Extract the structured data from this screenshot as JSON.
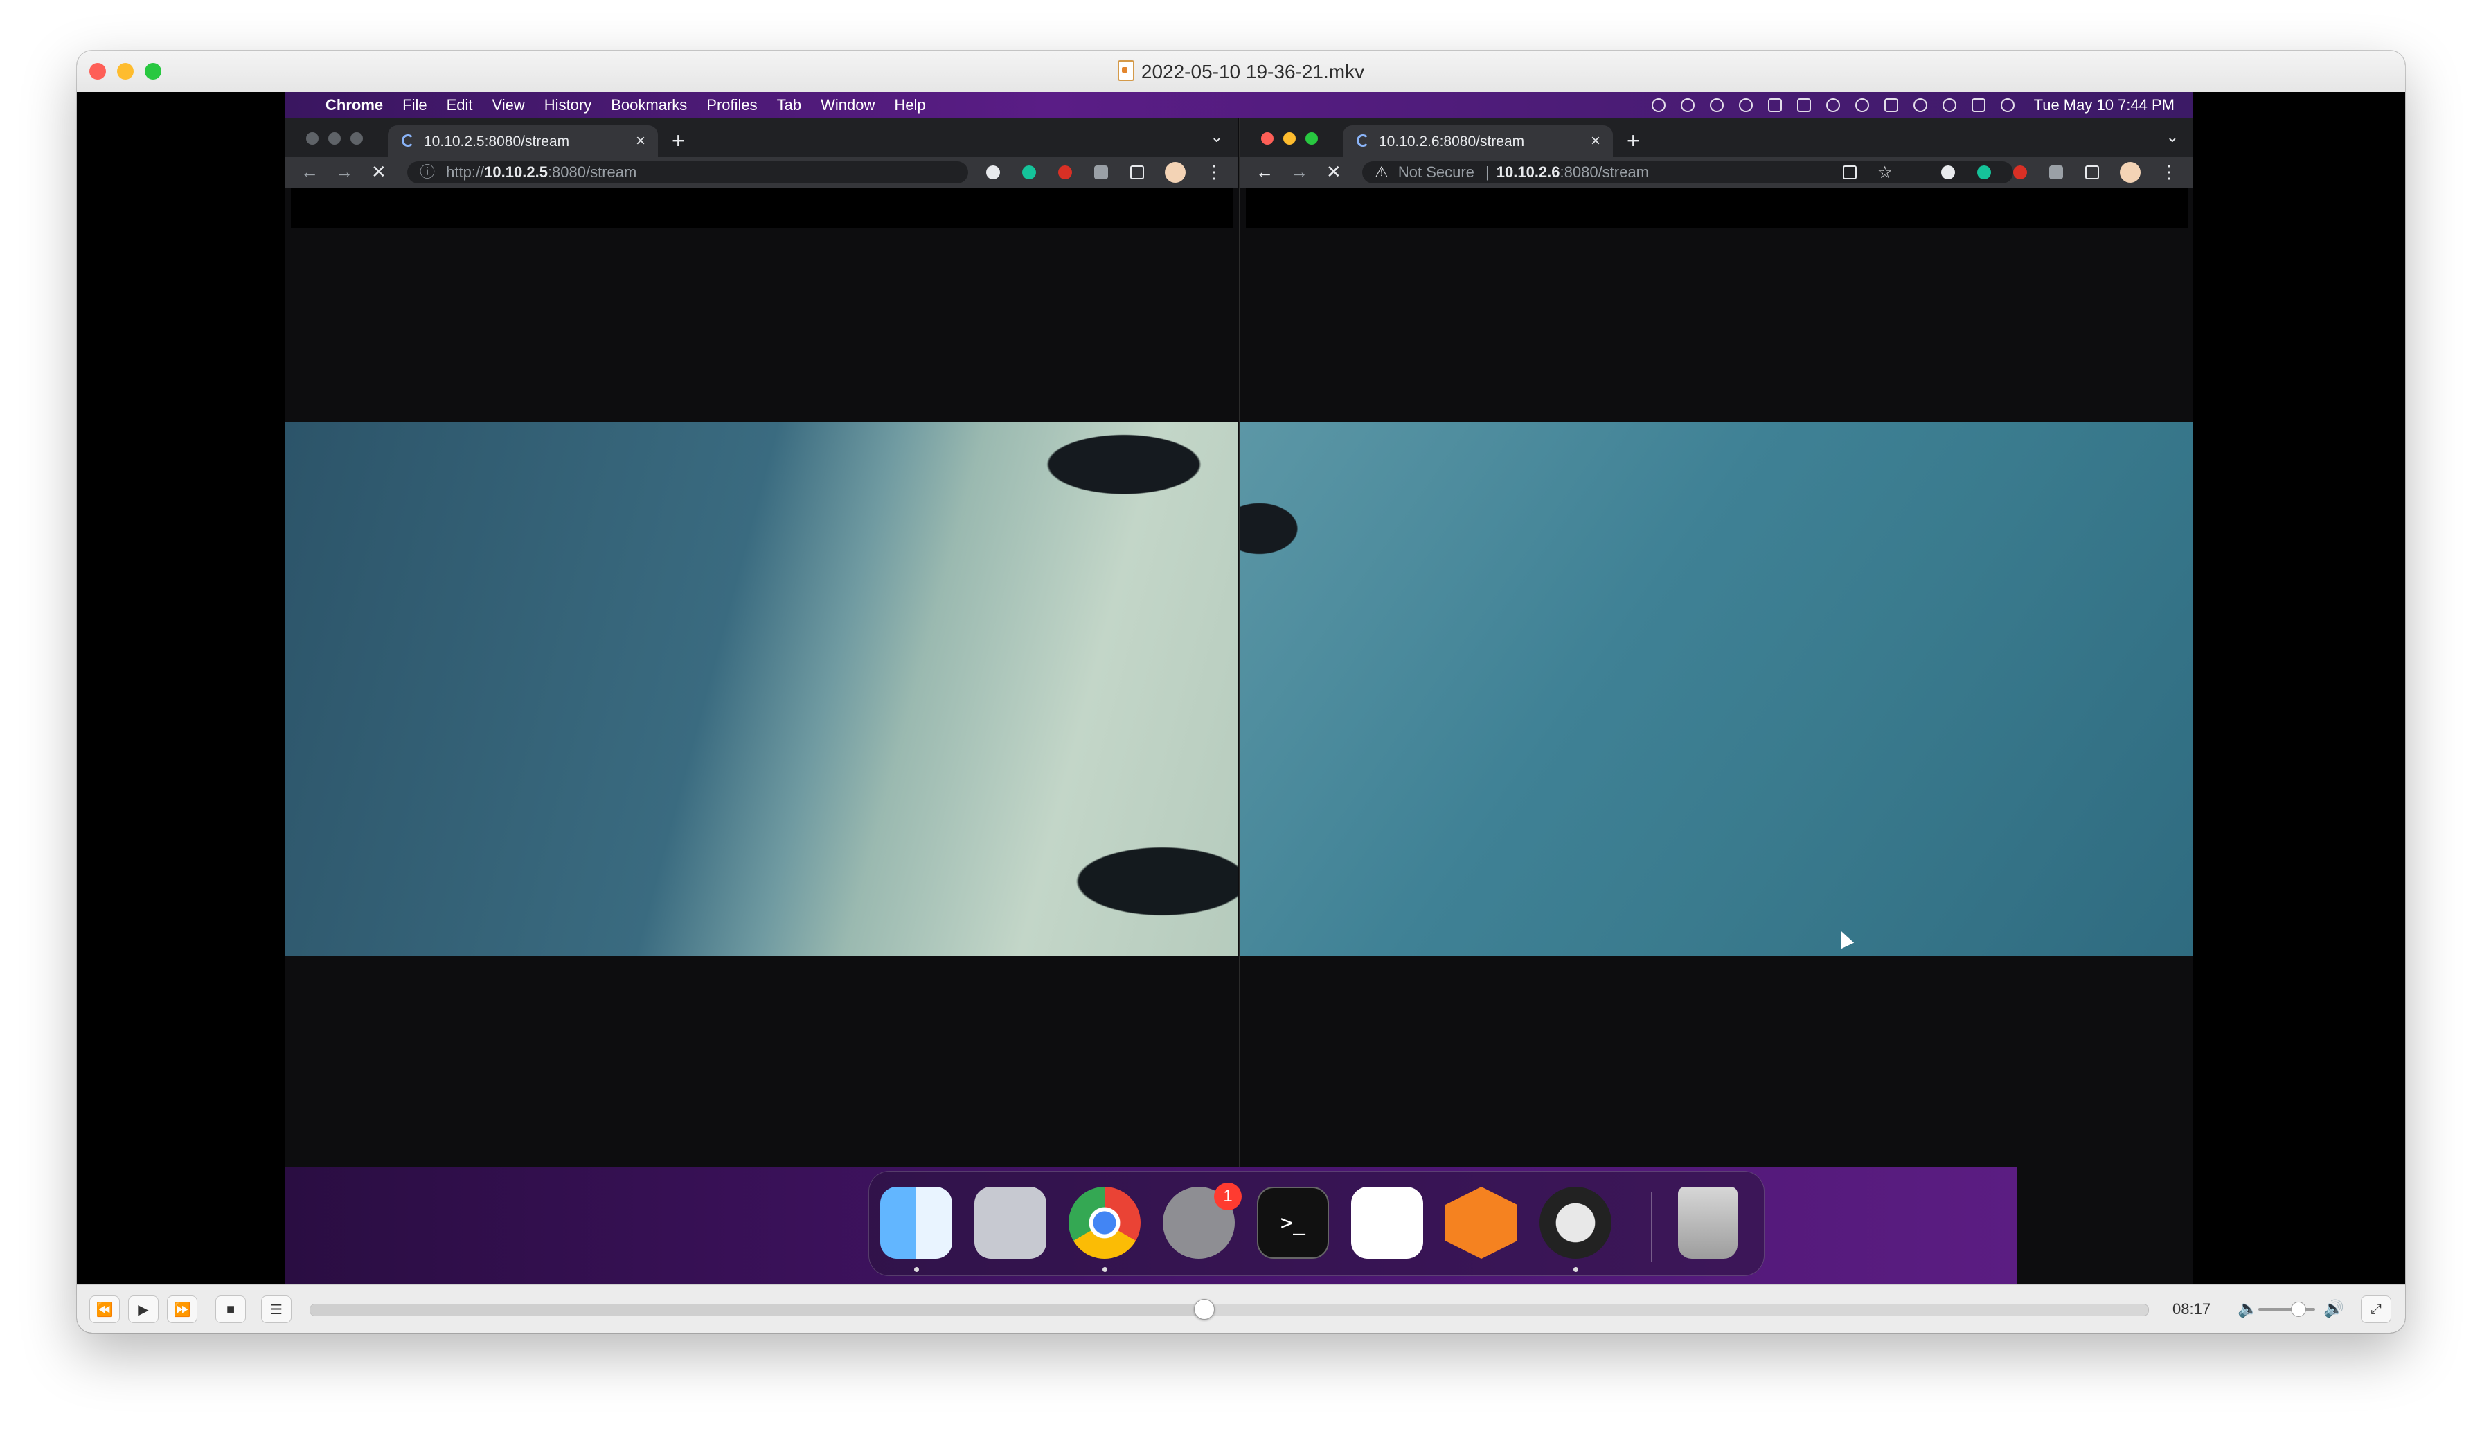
{
  "player": {
    "title": "2022-05-10 19-36-21.mkv",
    "time": "08:17",
    "progress": 0.486,
    "volume": 0.7,
    "controls": {
      "rewind": "⏪",
      "play": "▶",
      "fast_forward": "⏩",
      "stop": "■",
      "playlist": "☰",
      "fullscreen": "⤢"
    }
  },
  "menubar": {
    "apple": "",
    "app": "Chrome",
    "items": [
      "File",
      "Edit",
      "View",
      "History",
      "Bookmarks",
      "Profiles",
      "Tab",
      "Window",
      "Help"
    ],
    "clock": "Tue May 10  7:44 PM"
  },
  "browser_left": {
    "tab_title": "10.10.2.5:8080/stream",
    "url_scheme": "http://",
    "url_host": "10.10.2.5",
    "url_rest": ":8080/stream"
  },
  "browser_right": {
    "tab_title": "10.10.2.6:8080/stream",
    "security": "Not Secure",
    "url_host": "10.10.2.6",
    "url_rest": ":8080/stream"
  },
  "dock": {
    "items": [
      "finder",
      "launchpad",
      "chrome",
      "system-preferences",
      "terminal",
      "slack",
      "cloud-vpn",
      "obs",
      "trash"
    ],
    "settings_badge": "1",
    "terminal_label": ">_"
  },
  "colors": {
    "menubar": "#4a1a74",
    "tab_bar": "#202124",
    "toolbar": "#35363a"
  }
}
